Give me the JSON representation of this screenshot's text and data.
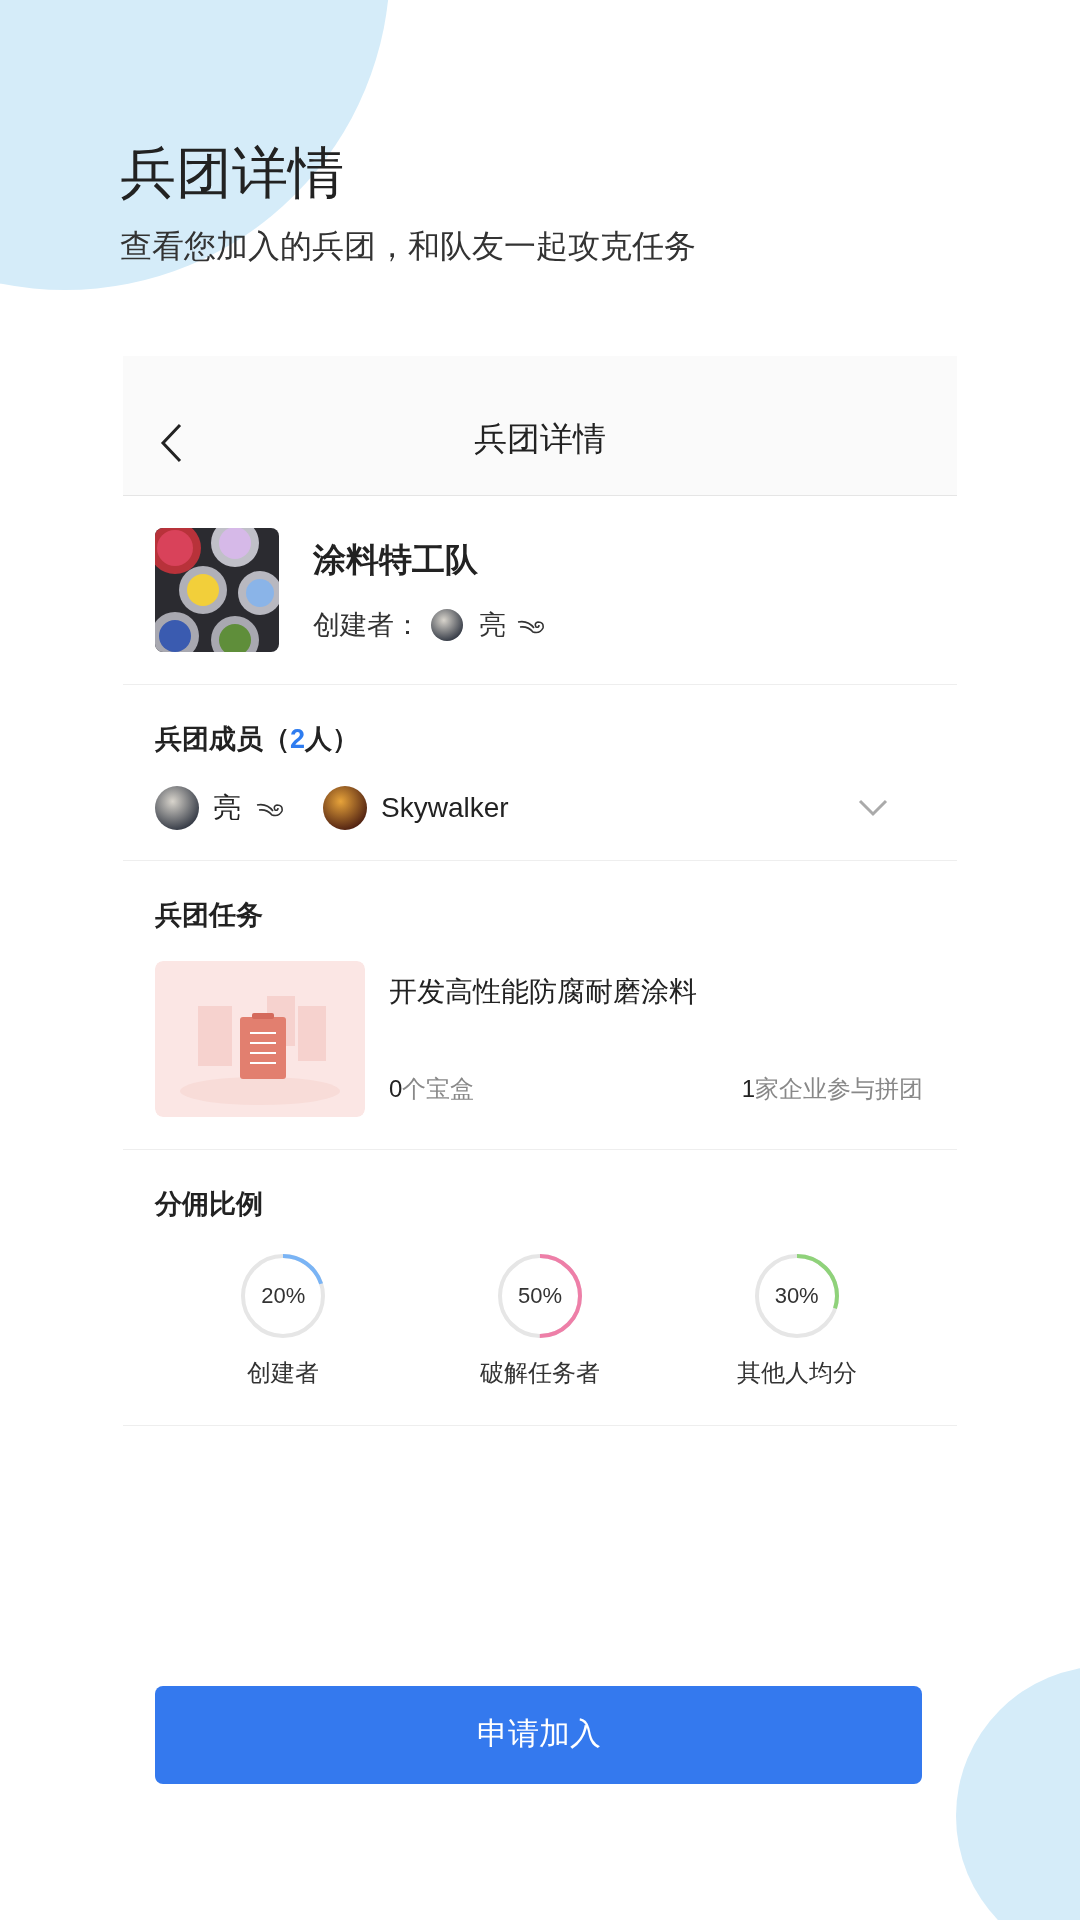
{
  "page_title": "兵团详情",
  "page_subtitle": "查看您加入的兵团，和队友一起攻克任务",
  "nav": {
    "title": "兵团详情"
  },
  "group": {
    "name": "涂料特工队",
    "creator_label": "创建者：",
    "creator_name": "亮"
  },
  "members": {
    "title_prefix": "兵团成员（",
    "count": "2",
    "title_suffix": "人）",
    "expanded": false,
    "items": [
      {
        "name": "亮",
        "kind": "swirl"
      },
      {
        "name": "Skywalker",
        "kind": "plain"
      }
    ]
  },
  "tasks": {
    "title": "兵团任务",
    "items": [
      {
        "title": "开发高性能防腐耐磨涂料",
        "boxes_count": "0",
        "boxes_label": "个宝盒",
        "companies_count": "1",
        "companies_label": "家企业参与拼团"
      }
    ]
  },
  "commission": {
    "title": "分佣比例",
    "items": [
      {
        "reading": "20%",
        "label": "创建者",
        "level": 0.2,
        "color": "#7ab4f5"
      },
      {
        "reading": "50%",
        "label": "破解任务者",
        "level": 0.5,
        "color": "#ee7fa8"
      },
      {
        "reading": "30%",
        "label": "其他人均分",
        "level": 0.3,
        "color": "#8fd27a"
      }
    ]
  },
  "join_button": "申请加入"
}
